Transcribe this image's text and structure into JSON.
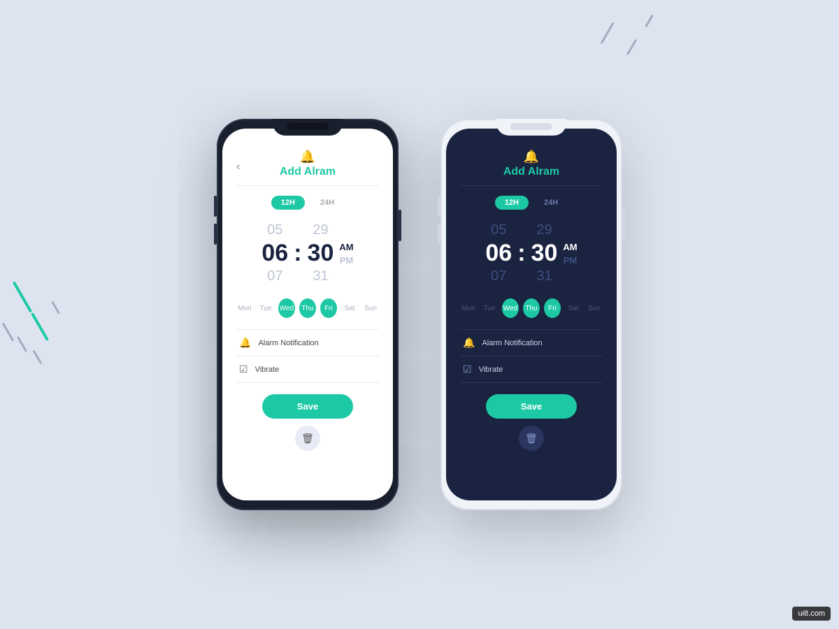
{
  "background": "#dde4ef",
  "accent": "#1dc9a4",
  "phone1": {
    "theme": "dark-shell",
    "title": "Add Alram",
    "back_label": "‹",
    "format_options": [
      "12H",
      "24H"
    ],
    "active_format": "12H",
    "time": {
      "hour_prev": "05",
      "hour_curr": "06",
      "hour_next": "07",
      "min_prev": "29",
      "min_curr": "30",
      "min_next": "31",
      "colon": ":",
      "ampm_active": "AM",
      "ampm_inactive": "PM"
    },
    "days": [
      {
        "label": "Mon",
        "active": false
      },
      {
        "label": "Tue",
        "active": false
      },
      {
        "label": "Wed",
        "active": true
      },
      {
        "label": "Thu",
        "active": true
      },
      {
        "label": "Fri",
        "active": true
      },
      {
        "label": "Sat",
        "active": false
      },
      {
        "label": "Sun",
        "active": false
      }
    ],
    "settings": [
      {
        "icon": "🔔",
        "label": "Alarm Notification"
      },
      {
        "icon": "☑",
        "label": "Vibrate"
      }
    ],
    "save_label": "Save",
    "delete_icon": "🗑"
  },
  "phone2": {
    "theme": "light-shell",
    "title": "Add Alram",
    "format_options": [
      "12H",
      "24H"
    ],
    "active_format": "12H",
    "time": {
      "hour_prev": "05",
      "hour_curr": "06",
      "hour_next": "07",
      "min_prev": "29",
      "min_curr": "30",
      "min_next": "31",
      "colon": ":",
      "ampm_active": "AM",
      "ampm_inactive": "PM"
    },
    "days": [
      {
        "label": "Mon",
        "active": false
      },
      {
        "label": "Tue",
        "active": false
      },
      {
        "label": "Wed",
        "active": true
      },
      {
        "label": "Thu",
        "active": true
      },
      {
        "label": "Fri",
        "active": true
      },
      {
        "label": "Sat",
        "active": false
      },
      {
        "label": "Sun",
        "active": false
      }
    ],
    "settings": [
      {
        "icon": "🔔",
        "label": "Alarm Notification"
      },
      {
        "icon": "☑",
        "label": "Vibrate"
      }
    ],
    "save_label": "Save",
    "delete_icon": "🗑"
  },
  "watermark": "ui8.com"
}
